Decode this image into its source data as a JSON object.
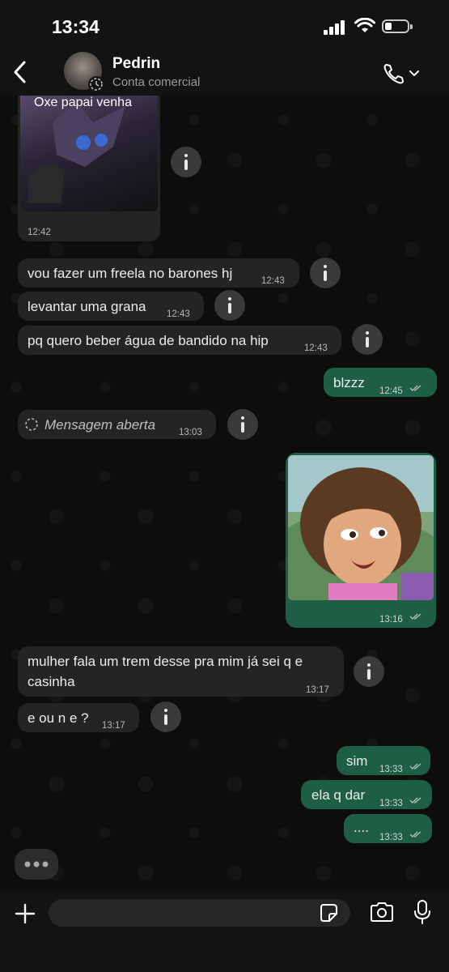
{
  "status": {
    "time": "13:34"
  },
  "header": {
    "name": "Pedrin",
    "subtitle": "Conta comercial"
  },
  "messages": [
    {
      "dir": "in",
      "type": "image",
      "caption": "Oxe papai venha",
      "time": "12:42"
    },
    {
      "dir": "in",
      "type": "text",
      "text": "vou fazer um freela no barones hj",
      "time": "12:43"
    },
    {
      "dir": "in",
      "type": "text",
      "text": "levantar uma grana",
      "time": "12:43"
    },
    {
      "dir": "in",
      "type": "text",
      "text": "pq quero beber água de bandido na hip",
      "time": "12:43"
    },
    {
      "dir": "out",
      "type": "text",
      "text": "blzzz",
      "time": "12:45"
    },
    {
      "dir": "in",
      "type": "view-once",
      "text": "Mensagem aberta",
      "time": "13:03"
    },
    {
      "dir": "out",
      "type": "image",
      "time": "13:16"
    },
    {
      "dir": "in",
      "type": "text",
      "text_line1": "mulher fala um trem desse pra mim já sei q e",
      "text_line2": "casinha",
      "time": "13:17"
    },
    {
      "dir": "in",
      "type": "text",
      "text": "e ou n e ?",
      "time": "13:17"
    },
    {
      "dir": "out",
      "type": "text",
      "text": "sim",
      "time": "13:33"
    },
    {
      "dir": "out",
      "type": "text",
      "text": "ela q dar",
      "time": "13:33"
    },
    {
      "dir": "out",
      "type": "text",
      "text": "....",
      "time": "13:33"
    }
  ],
  "icons": {
    "back": "chevron-left-icon",
    "call": "phone-icon",
    "info": "info-icon",
    "plus": "plus-icon",
    "sticker": "sticker-icon",
    "camera": "camera-icon",
    "mic": "microphone-icon",
    "typing": "typing-indicator-icon",
    "view_once": "view-once-icon"
  },
  "colors": {
    "incoming": "#242424",
    "outgoing": "#1d5e45",
    "background": "#0b0b0b",
    "read_ticks": "#53bdeb"
  }
}
